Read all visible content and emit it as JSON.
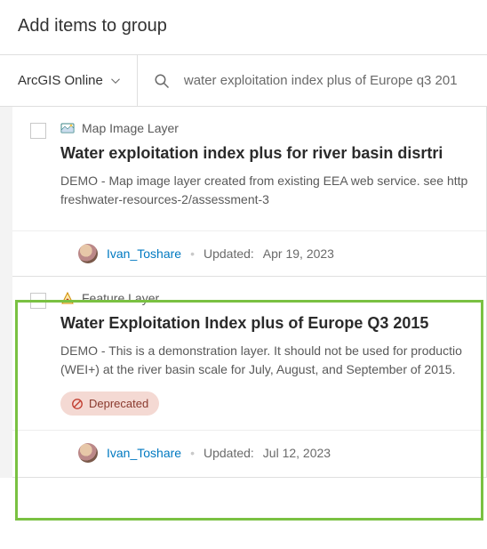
{
  "header": {
    "title": "Add items to group"
  },
  "filter": {
    "source_label": "ArcGIS Online",
    "search_value": "water exploitation index plus of Europe q3 201"
  },
  "items": [
    {
      "type_label": "Map Image Layer",
      "title": "Water exploitation index plus for river basin disrtri",
      "description": "DEMO - Map image layer created from existing EEA web service. see http\nfreshwater-resources-2/assessment-3",
      "owner": "Ivan_Toshare",
      "updated_label": "Updated:",
      "updated_value": "Apr 19, 2023",
      "deprecated": false
    },
    {
      "type_label": "Feature Layer",
      "title": "Water Exploitation Index plus of Europe Q3 2015",
      "description": "DEMO - This is a demonstration layer. It should not be used for productio\n(WEI+) at the river basin scale for July, August, and September of 2015.",
      "owner": "Ivan_Toshare",
      "updated_label": "Updated:",
      "updated_value": "Jul 12, 2023",
      "deprecated": true,
      "deprecated_label": "Deprecated"
    }
  ]
}
